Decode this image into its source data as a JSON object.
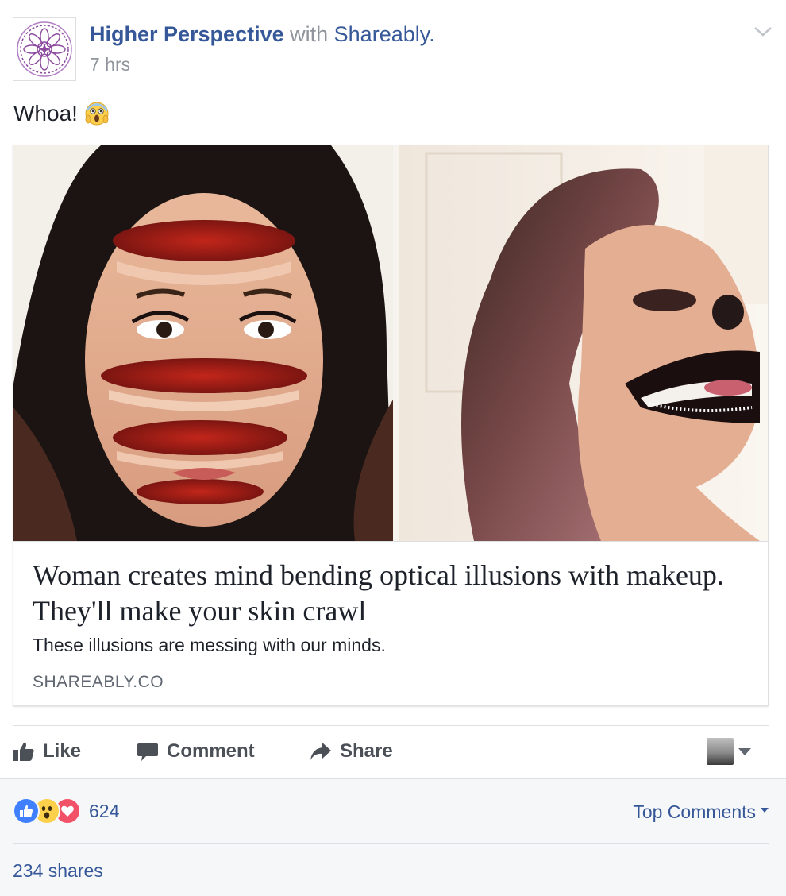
{
  "header": {
    "author": "Higher Perspective",
    "with_text": "with",
    "tagged_page": "Shareably.",
    "timestamp": "7 hrs"
  },
  "post": {
    "text": "Whoa!",
    "emoji": "face-screaming-in-fear"
  },
  "link_card": {
    "title": "Woman creates mind bending optical illusions with makeup. They'll make your skin crawl",
    "description": "These illusions are messing with our minds.",
    "domain": "SHAREABLY.CO"
  },
  "actions": {
    "like_label": "Like",
    "comment_label": "Comment",
    "share_label": "Share"
  },
  "footer": {
    "reaction_icons": [
      "like-reaction-icon",
      "wow-reaction-icon",
      "love-reaction-icon"
    ],
    "reaction_count": "624",
    "top_comments_label": "Top Comments",
    "shares_text": "234 shares"
  },
  "colors": {
    "link_blue": "#365899",
    "meta_gray": "#90949c",
    "action_gray": "#4b4f56",
    "footer_bg": "#f6f7f9",
    "like_blue": "#4080ff",
    "love_red": "#f25268",
    "wow_yellow": "#fcd04a",
    "mandala_purple": "#8b4a9e"
  }
}
